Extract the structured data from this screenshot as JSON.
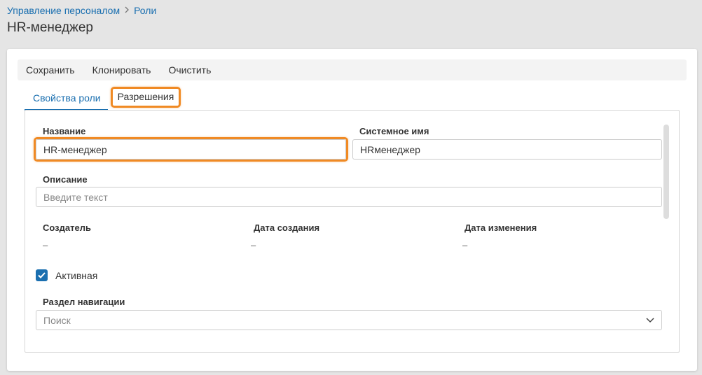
{
  "breadcrumb": {
    "items": [
      "Управление персоналом",
      "Роли"
    ],
    "separator": ">"
  },
  "page_title": "HR-менеджер",
  "toolbar": {
    "save_label": "Сохранить",
    "clone_label": "Клонировать",
    "clear_label": "Очистить"
  },
  "tabs": [
    {
      "label": "Свойства роли",
      "active": true
    },
    {
      "label": "Разрешения",
      "active": false
    }
  ],
  "form": {
    "name_label": "Название",
    "name_value": "HR-менеджер",
    "system_name_label": "Системное имя",
    "system_name_value": "HRменеджер",
    "description_label": "Описание",
    "description_placeholder": "Введите текст",
    "creator_label": "Создатель",
    "creator_value": "–",
    "created_label": "Дата создания",
    "created_value": "–",
    "modified_label": "Дата изменения",
    "modified_value": "–",
    "active_label": "Активная",
    "active_checked": true,
    "nav_section_label": "Раздел навигации",
    "nav_section_placeholder": "Поиск"
  },
  "colors": {
    "accent": "#1a6fb0",
    "highlight": "#f08a24"
  },
  "icons": {
    "breadcrumb_separator": "chevron-right-icon",
    "select_arrow": "chevron-down-icon",
    "checkbox": "checkmark-icon"
  }
}
